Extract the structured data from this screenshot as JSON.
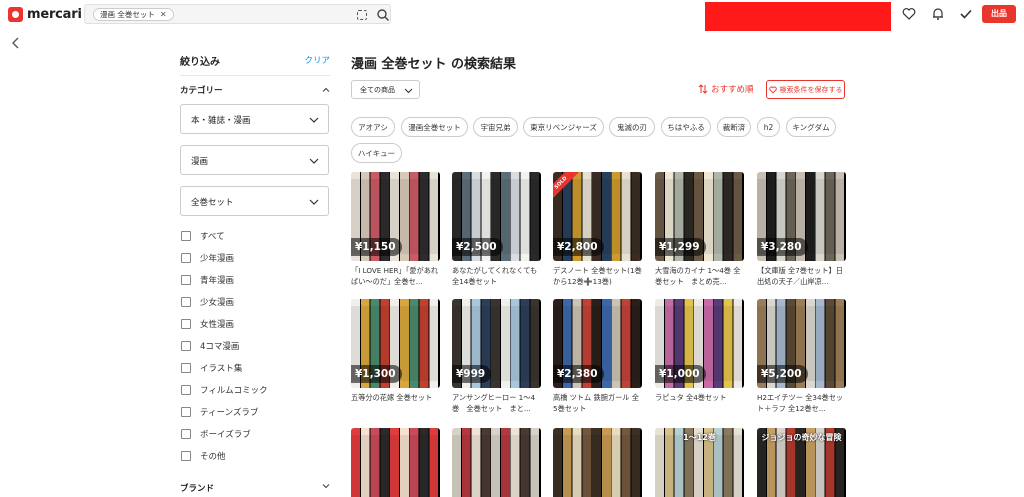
{
  "header": {
    "logo_text": "mercari",
    "search_chip": "漫画 全巻セット",
    "sell_label": "出品",
    "icons": [
      "search-icon",
      "heart-icon",
      "bell-icon",
      "check-icon"
    ]
  },
  "sidebar": {
    "title": "絞り込み",
    "clear": "クリア",
    "category_title": "カテゴリー",
    "selects": [
      "本・雑誌・漫画",
      "漫画",
      "全巻セット"
    ],
    "checkboxes": [
      "すべて",
      "少年漫画",
      "青年漫画",
      "少女漫画",
      "女性漫画",
      "4コマ漫画",
      "イラスト集",
      "フィルムコミック",
      "ティーンズラブ",
      "ボーイズラブ",
      "その他"
    ],
    "brand_title": "ブランド"
  },
  "main": {
    "title": "漫画 全巻セット の検索結果",
    "sort_value": "全ての商品",
    "recommend": "おすすめ順",
    "save_search": "検索条件を保存する",
    "tags": [
      "アオアシ",
      "漫画全巻セット",
      "宇宙兄弟",
      "東京リベンジャーズ",
      "鬼滅の刃",
      "ちはやふる",
      "裁断済",
      "h2",
      "キングダム",
      "ハイキュー"
    ],
    "items": [
      {
        "price": "¥1,150",
        "name": "「I LOVE HER」「愛があればい〜のだ」全巻セ...",
        "sold": false
      },
      {
        "price": "¥2,500",
        "name": "あなたがしてくれなくても 全14巻セット",
        "sold": false
      },
      {
        "price": "¥2,800",
        "name": "デスノート 全巻セット(1巻から12巻➕13巻)",
        "sold": true,
        "sold_label": "SOLD"
      },
      {
        "price": "¥1,299",
        "name": "大雪海のカイナ 1〜4巻 全巻セット　まとめ売...",
        "sold": false
      },
      {
        "price": "¥3,280",
        "name": "【文庫版 全7巻セット】日出処の天子／山岸凉...",
        "sold": false
      },
      {
        "price": "¥1,300",
        "name": "五等分の花嫁 全巻セット",
        "sold": false
      },
      {
        "price": "¥999",
        "name": "アンサングヒーロー 1〜4巻　全巻セット　まと...",
        "sold": false
      },
      {
        "price": "¥2,380",
        "name": "高橋 ツトム 鉄腕ガール 全5巻セット",
        "sold": false
      },
      {
        "price": "¥1,000",
        "name": "ラピュタ 全4巻セット",
        "sold": false
      },
      {
        "price": "¥5,200",
        "name": "H2エイチツー 全34巻セット＋ラフ 全12巻セ...",
        "sold": false
      },
      {
        "price": "",
        "name": "",
        "sold": false
      },
      {
        "price": "",
        "name": "",
        "sold": false
      },
      {
        "price": "",
        "name": "",
        "sold": false
      },
      {
        "price": "",
        "name": "",
        "overlay": "1〜12巻",
        "sold": false
      },
      {
        "price": "",
        "name": "",
        "overlay": "ジョジョの奇妙な冒険",
        "sold": false
      }
    ]
  },
  "colors": {
    "accent": "#ea352d",
    "link": "#0095ee"
  }
}
